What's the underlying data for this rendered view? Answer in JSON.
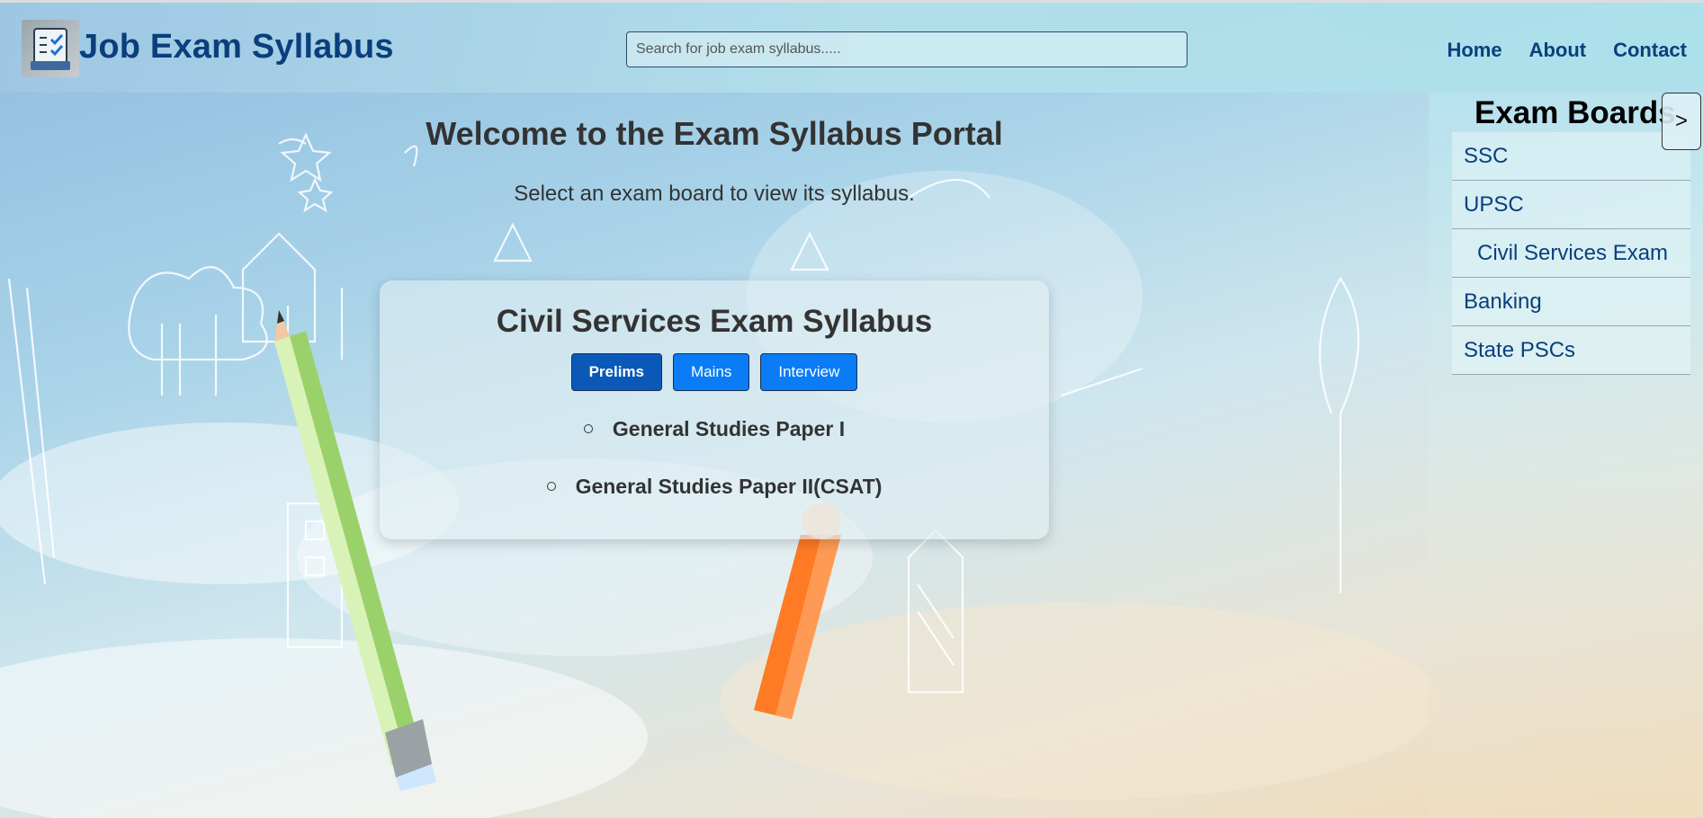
{
  "header": {
    "title": "Job Exam Syllabus",
    "logo_icon": "syllabus-logo-icon",
    "search_placeholder": "Search for job exam syllabus.....",
    "nav": [
      "Home",
      "About",
      "Contact"
    ]
  },
  "main": {
    "welcome": "Welcome to the Exam Syllabus Portal",
    "subtitle": "Select an exam board to view its syllabus.",
    "card": {
      "title": "Civil Services Exam Syllabus",
      "tabs": [
        "Prelims",
        "Mains",
        "Interview"
      ],
      "active_tab": "Prelims",
      "items": [
        "General Studies Paper I",
        "General Studies Paper II(CSAT)"
      ]
    }
  },
  "sidebar": {
    "title": "Exam Boards",
    "toggle_label": ">",
    "items": [
      "SSC",
      "UPSC",
      "Civil Services Exam",
      "Banking",
      "State PSCs"
    ]
  },
  "colors": {
    "brand": "#0a3f7d",
    "button": "#0a7cf5",
    "button_active": "#0a59b8"
  }
}
